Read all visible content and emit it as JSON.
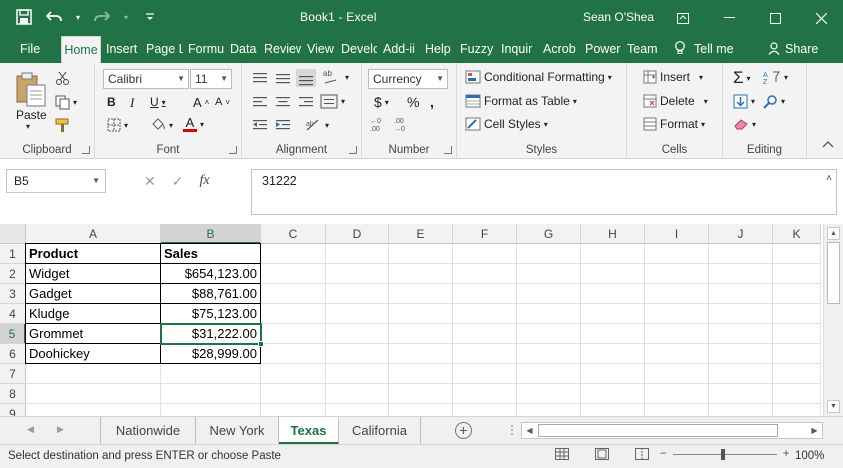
{
  "app": {
    "title": "Book1  -  Excel",
    "user": "Sean O'Shea"
  },
  "qat": {
    "save_icon": "save-icon",
    "undo_icon": "undo-icon",
    "redo_icon": "redo-icon"
  },
  "ribbon_tabs": [
    "File",
    "Home",
    "Insert",
    "Page L",
    "Formu",
    "Data",
    "Review",
    "View",
    "Develo",
    "Add-ii",
    "Help",
    "Fuzzy",
    "Inquir",
    "Acrob",
    "Power",
    "Team"
  ],
  "tellme": "Tell me",
  "share": "Share",
  "clipboard": {
    "paste": "Paste",
    "label": "Clipboard"
  },
  "font": {
    "name": "Calibri",
    "size": "11",
    "label": "Font"
  },
  "alignment": {
    "label": "Alignment"
  },
  "number": {
    "format": "Currency",
    "label": "Number"
  },
  "styles": {
    "conditional": "Conditional Formatting",
    "format_table": "Format as Table",
    "cell_styles": "Cell Styles",
    "label": "Styles"
  },
  "cells": {
    "insert": "Insert",
    "delete": "Delete",
    "format": "Format",
    "label": "Cells"
  },
  "editing": {
    "label": "Editing"
  },
  "formula_bar": {
    "name_box": "B5",
    "formula": "31222",
    "fx": "fx"
  },
  "columns": [
    "A",
    "B",
    "C",
    "D",
    "E",
    "F",
    "G",
    "H",
    "I",
    "J",
    "K"
  ],
  "rows": [
    "1",
    "2",
    "3",
    "4",
    "5",
    "6",
    "7",
    "8",
    "9"
  ],
  "table": {
    "headers": [
      "Product",
      "Sales"
    ],
    "data": [
      [
        "Widget",
        "$654,123.00"
      ],
      [
        "Gadget",
        "$88,761.00"
      ],
      [
        "Kludge",
        "$75,123.00"
      ],
      [
        "Grommet",
        "$31,222.00"
      ],
      [
        "Doohickey",
        "$28,999.00"
      ]
    ]
  },
  "sheets": [
    "Nationwide",
    "New York",
    "Texas",
    "California"
  ],
  "active_sheet": "Texas",
  "status": {
    "message": "Select destination and press ENTER or choose Paste",
    "zoom": "100%"
  },
  "colors": {
    "accent": "#217346",
    "selection_border": "#217346"
  }
}
